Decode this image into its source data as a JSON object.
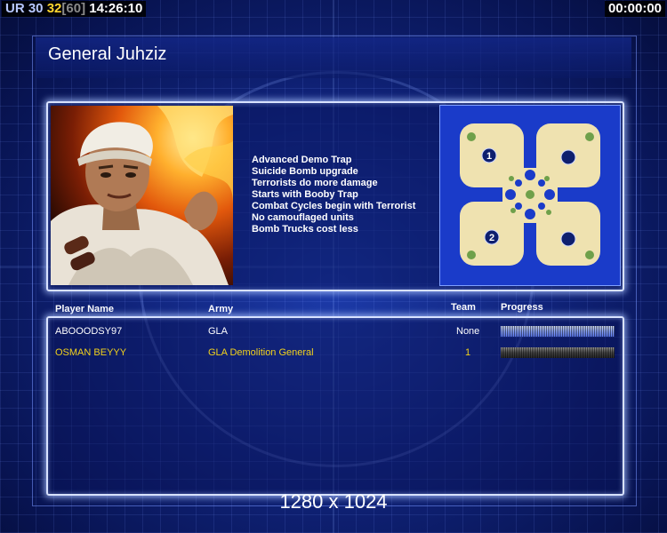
{
  "hud": {
    "ur_label": "UR",
    "value_a": "30",
    "value_b": "32",
    "value_c": "[60]",
    "clock": "14:26:10",
    "timer": "00:00:00"
  },
  "title": "General Juhziz",
  "bonuses": [
    "Advanced Demo Trap",
    "Suicide Bomb upgrade",
    "Terrorists do more damage",
    "Starts with Booby Trap",
    "Combat Cycles begin with Terrorist",
    "No camouflaged units",
    "Bomb Trucks cost less"
  ],
  "minimap": {
    "start_labels": [
      "1",
      "2"
    ]
  },
  "table": {
    "headers": {
      "player": "Player Name",
      "army": "Army",
      "team": "Team",
      "progress": "Progress"
    },
    "rows": [
      {
        "player": "ABOOODSY97",
        "army": "GLA",
        "team": "None",
        "progress": 1.0
      },
      {
        "player": "OSMAN BEYYY",
        "army": "GLA Demolition General",
        "team": "1",
        "progress": 0.0
      }
    ]
  },
  "resolution": "1280 x 1024",
  "colors": {
    "background": "#10237a",
    "panel_border": "#d8e2ff",
    "local_player": "#f2d21c",
    "hud_gold": "#ffd52e"
  }
}
